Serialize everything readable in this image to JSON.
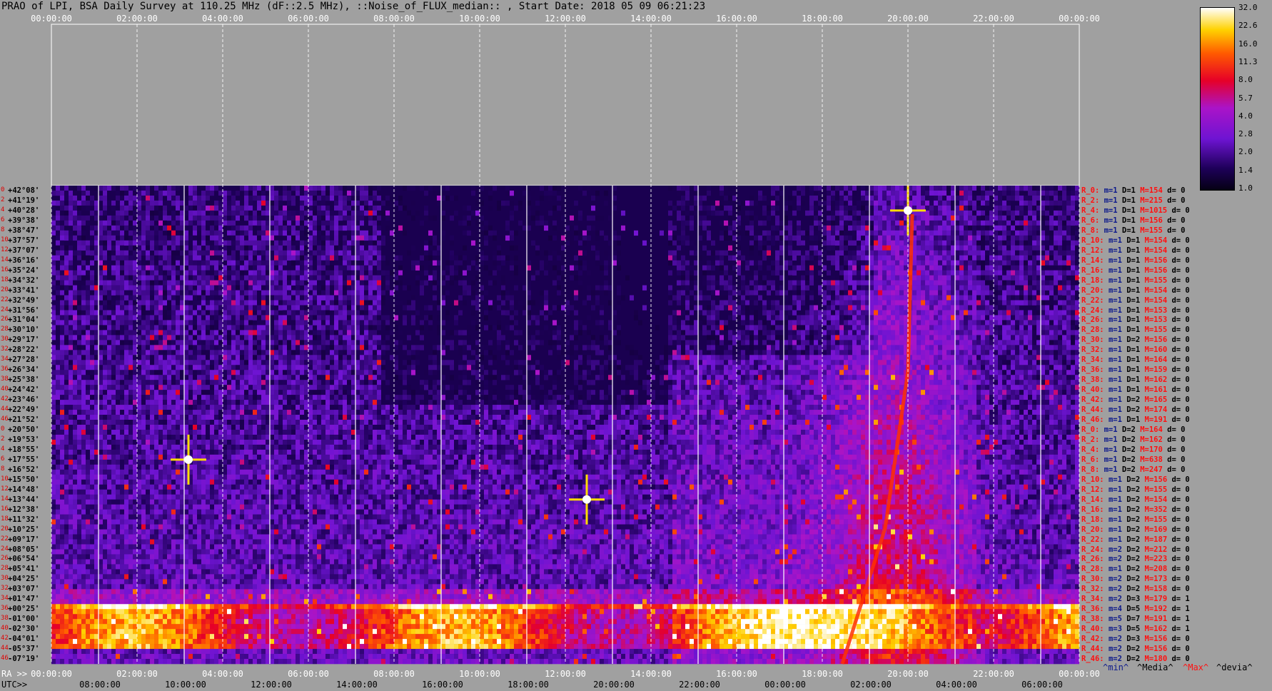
{
  "header": {
    "title": "PRAO of LPI, BSA Daily Survey at 110.25 MHz (dF::2.5 MHz), ::Noise_of_FLUX_median:: , Start Date: 2018 05 09 06:21:23"
  },
  "axis_labels": {
    "ra_prefix": "RA >>",
    "utc_prefix": "UTC>>"
  },
  "colorbar": {
    "labels": [
      "32.0",
      "22.6",
      "16.0",
      "11.3",
      "8.0",
      "5.7",
      "4.0",
      "2.8",
      "2.0",
      "1.4",
      "1.0"
    ]
  },
  "legend": {
    "min": "^min^",
    "median": "^Media^",
    "max": "^Max^",
    "dev": "^devia^"
  },
  "colors": {
    "background": "#a0a0a0",
    "plot_dark": "#0a0030",
    "accent_red": "#ff1010",
    "accent_navy": "#0d1a8c"
  },
  "right_rows": [
    {
      "r": "R_0:",
      "m": "m=1",
      "d": "D=1",
      "mx": "M=154",
      "dv": "d= 0"
    },
    {
      "r": "R_2:",
      "m": "m=1",
      "d": "D=1",
      "mx": "M=215",
      "dv": "d= 0"
    },
    {
      "r": "R_4:",
      "m": "m=1",
      "d": "D=1",
      "mx": "M=1015",
      "dv": "d= 0"
    },
    {
      "r": "R_6:",
      "m": "m=1",
      "d": "D=1",
      "mx": "M=156",
      "dv": "d= 0"
    },
    {
      "r": "R_8:",
      "m": "m=1",
      "d": "D=1",
      "mx": "M=155",
      "dv": "d= 0"
    },
    {
      "r": "R_10:",
      "m": "m=1",
      "d": "D=1",
      "mx": "M=154",
      "dv": "d= 0"
    },
    {
      "r": "R_12:",
      "m": "m=1",
      "d": "D=1",
      "mx": "M=154",
      "dv": "d= 0"
    },
    {
      "r": "R_14:",
      "m": "m=1",
      "d": "D=1",
      "mx": "M=156",
      "dv": "d= 0"
    },
    {
      "r": "R_16:",
      "m": "m=1",
      "d": "D=1",
      "mx": "M=156",
      "dv": "d= 0"
    },
    {
      "r": "R_18:",
      "m": "m=1",
      "d": "D=1",
      "mx": "M=155",
      "dv": "d= 0"
    },
    {
      "r": "R_20:",
      "m": "m=1",
      "d": "D=1",
      "mx": "M=154",
      "dv": "d= 0"
    },
    {
      "r": "R_22:",
      "m": "m=1",
      "d": "D=1",
      "mx": "M=154",
      "dv": "d= 0"
    },
    {
      "r": "R_24:",
      "m": "m=1",
      "d": "D=1",
      "mx": "M=153",
      "dv": "d= 0"
    },
    {
      "r": "R_26:",
      "m": "m=1",
      "d": "D=1",
      "mx": "M=153",
      "dv": "d= 0"
    },
    {
      "r": "R_28:",
      "m": "m=1",
      "d": "D=1",
      "mx": "M=155",
      "dv": "d= 0"
    },
    {
      "r": "R_30:",
      "m": "m=1",
      "d": "D=2",
      "mx": "M=156",
      "dv": "d= 0"
    },
    {
      "r": "R_32:",
      "m": "m=1",
      "d": "D=1",
      "mx": "M=160",
      "dv": "d= 0"
    },
    {
      "r": "R_34:",
      "m": "m=1",
      "d": "D=1",
      "mx": "M=164",
      "dv": "d= 0"
    },
    {
      "r": "R_36:",
      "m": "m=1",
      "d": "D=1",
      "mx": "M=159",
      "dv": "d= 0"
    },
    {
      "r": "R_38:",
      "m": "m=1",
      "d": "D=1",
      "mx": "M=162",
      "dv": "d= 0"
    },
    {
      "r": "R_40:",
      "m": "m=1",
      "d": "D=1",
      "mx": "M=161",
      "dv": "d= 0"
    },
    {
      "r": "R_42:",
      "m": "m=1",
      "d": "D=2",
      "mx": "M=165",
      "dv": "d= 0"
    },
    {
      "r": "R_44:",
      "m": "m=1",
      "d": "D=2",
      "mx": "M=174",
      "dv": "d= 0"
    },
    {
      "r": "R_46:",
      "m": "m=1",
      "d": "D=1",
      "mx": "M=191",
      "dv": "d= 0"
    },
    {
      "r": "R_0:",
      "m": "m=1",
      "d": "D=2",
      "mx": "M=164",
      "dv": "d= 0"
    },
    {
      "r": "R_2:",
      "m": "m=1",
      "d": "D=2",
      "mx": "M=162",
      "dv": "d= 0"
    },
    {
      "r": "R_4:",
      "m": "m=1",
      "d": "D=2",
      "mx": "M=170",
      "dv": "d= 0"
    },
    {
      "r": "R_6:",
      "m": "m=1",
      "d": "D=2",
      "mx": "M=638",
      "dv": "d= 0"
    },
    {
      "r": "R_8:",
      "m": "m=1",
      "d": "D=2",
      "mx": "M=247",
      "dv": "d= 0"
    },
    {
      "r": "R_10:",
      "m": "m=1",
      "d": "D=2",
      "mx": "M=156",
      "dv": "d= 0"
    },
    {
      "r": "R_12:",
      "m": "m=1",
      "d": "D=2",
      "mx": "M=155",
      "dv": "d= 0"
    },
    {
      "r": "R_14:",
      "m": "m=1",
      "d": "D=2",
      "mx": "M=154",
      "dv": "d= 0"
    },
    {
      "r": "R_16:",
      "m": "m=1",
      "d": "D=2",
      "mx": "M=352",
      "dv": "d= 0"
    },
    {
      "r": "R_18:",
      "m": "m=1",
      "d": "D=2",
      "mx": "M=155",
      "dv": "d= 0"
    },
    {
      "r": "R_20:",
      "m": "m=1",
      "d": "D=2",
      "mx": "M=169",
      "dv": "d= 0"
    },
    {
      "r": "R_22:",
      "m": "m=1",
      "d": "D=2",
      "mx": "M=187",
      "dv": "d= 0"
    },
    {
      "r": "R_24:",
      "m": "m=2",
      "d": "D=2",
      "mx": "M=212",
      "dv": "d= 0"
    },
    {
      "r": "R_26:",
      "m": "m=2",
      "d": "D=2",
      "mx": "M=223",
      "dv": "d= 0"
    },
    {
      "r": "R_28:",
      "m": "m=1",
      "d": "D=2",
      "mx": "M=208",
      "dv": "d= 0"
    },
    {
      "r": "R_30:",
      "m": "m=2",
      "d": "D=2",
      "mx": "M=173",
      "dv": "d= 0"
    },
    {
      "r": "R_32:",
      "m": "m=2",
      "d": "D=2",
      "mx": "M=158",
      "dv": "d= 0"
    },
    {
      "r": "R_34:",
      "m": "m=2",
      "d": "D=3",
      "mx": "M=179",
      "dv": "d= 1"
    },
    {
      "r": "R_36:",
      "m": "m=4",
      "d": "D=5",
      "mx": "M=192",
      "dv": "d= 1"
    },
    {
      "r": "R_38:",
      "m": "m=5",
      "d": "D=7",
      "mx": "M=191",
      "dv": "d= 1"
    },
    {
      "r": "R_40:",
      "m": "m=3",
      "d": "D=5",
      "mx": "M=162",
      "dv": "d= 1"
    },
    {
      "r": "R_42:",
      "m": "m=2",
      "d": "D=3",
      "mx": "M=156",
      "dv": "d= 0"
    },
    {
      "r": "R_44:",
      "m": "m=2",
      "d": "D=2",
      "mx": "M=156",
      "dv": "d= 0"
    },
    {
      "r": "R_46:",
      "m": "m=2",
      "d": "D=2",
      "mx": "M=180",
      "dv": "d= 0"
    }
  ],
  "chart_data": {
    "type": "heatmap",
    "title": "PRAO of LPI, BSA Daily Survey at 110.25 MHz (dF::2.5 MHz), ::Noise_of_FLUX_median:: , Start Date: 2018 05 09 06:21:23",
    "x_top_ticks": [
      "00:00:00",
      "02:00:00",
      "04:00:00",
      "06:00:00",
      "08:00:00",
      "10:00:00",
      "12:00:00",
      "14:00:00",
      "16:00:00",
      "18:00:00",
      "20:00:00",
      "22:00:00",
      "00:00:00"
    ],
    "x_ra_ticks": [
      "00:00:00",
      "02:00:00",
      "04:00:00",
      "06:00:00",
      "08:00:00",
      "10:00:00",
      "12:00:00",
      "14:00:00",
      "16:00:00",
      "18:00:00",
      "20:00:00",
      "22:00:00",
      "00:00:00"
    ],
    "x_utc_ticks": [
      "08:00:00",
      "10:00:00",
      "12:00:00",
      "14:00:00",
      "16:00:00",
      "18:00:00",
      "20:00:00",
      "22:00:00",
      "00:00:00",
      "02:00:00",
      "04:00:00",
      "06:00:00"
    ],
    "y_dec_labels": [
      "+42°08'",
      "+41°19'",
      "+40°28'",
      "+39°38'",
      "+38°47'",
      "+37°57'",
      "+37°07'",
      "+36°16'",
      "+35°24'",
      "+34°32'",
      "+33°41'",
      "+32°49'",
      "+31°56'",
      "+31°04'",
      "+30°10'",
      "+29°17'",
      "+28°22'",
      "+27°28'",
      "+26°34'",
      "+25°38'",
      "+24°42'",
      "+23°46'",
      "+22°49'",
      "+21°52'",
      "+20°50'",
      "+19°53'",
      "+18°55'",
      "+17°55'",
      "+16°52'",
      "+15°50'",
      "+14°48'",
      "+13°44'",
      "+12°38'",
      "+11°32'",
      "+10°25'",
      "+09°17'",
      "+08°05'",
      "+06°54'",
      "+05°41'",
      "+04°25'",
      "+03°07'",
      "+01°47'",
      "+00°25'",
      "-01°00'",
      "-02°30'",
      "-04°01'",
      "-05°37'",
      "-07°19'"
    ],
    "y_index_labels": [
      "0",
      "2",
      "4",
      "6",
      "8",
      "10",
      "12",
      "14",
      "16",
      "18",
      "20",
      "22",
      "24",
      "26",
      "28",
      "30",
      "32",
      "34",
      "36",
      "38",
      "40",
      "42",
      "44",
      "46",
      "0",
      "2",
      "4",
      "6",
      "8",
      "10",
      "12",
      "14",
      "16",
      "18",
      "20",
      "22",
      "24",
      "26",
      "28",
      "30",
      "32",
      "34",
      "36",
      "38",
      "40",
      "42",
      "44",
      "46"
    ],
    "colorbar_scale": [
      1.0,
      1.4,
      2.0,
      2.8,
      4.0,
      5.7,
      8.0,
      11.3,
      16.0,
      22.6,
      32.0
    ],
    "bright_sources": [
      {
        "ra": "03:12",
        "dec": "+17°55'",
        "intensity": 32
      },
      {
        "ra": "20:00",
        "dec": "+40°28'",
        "intensity": 32
      },
      {
        "ra": "12:30",
        "dec": "+13°44'",
        "intensity": 16
      }
    ]
  }
}
